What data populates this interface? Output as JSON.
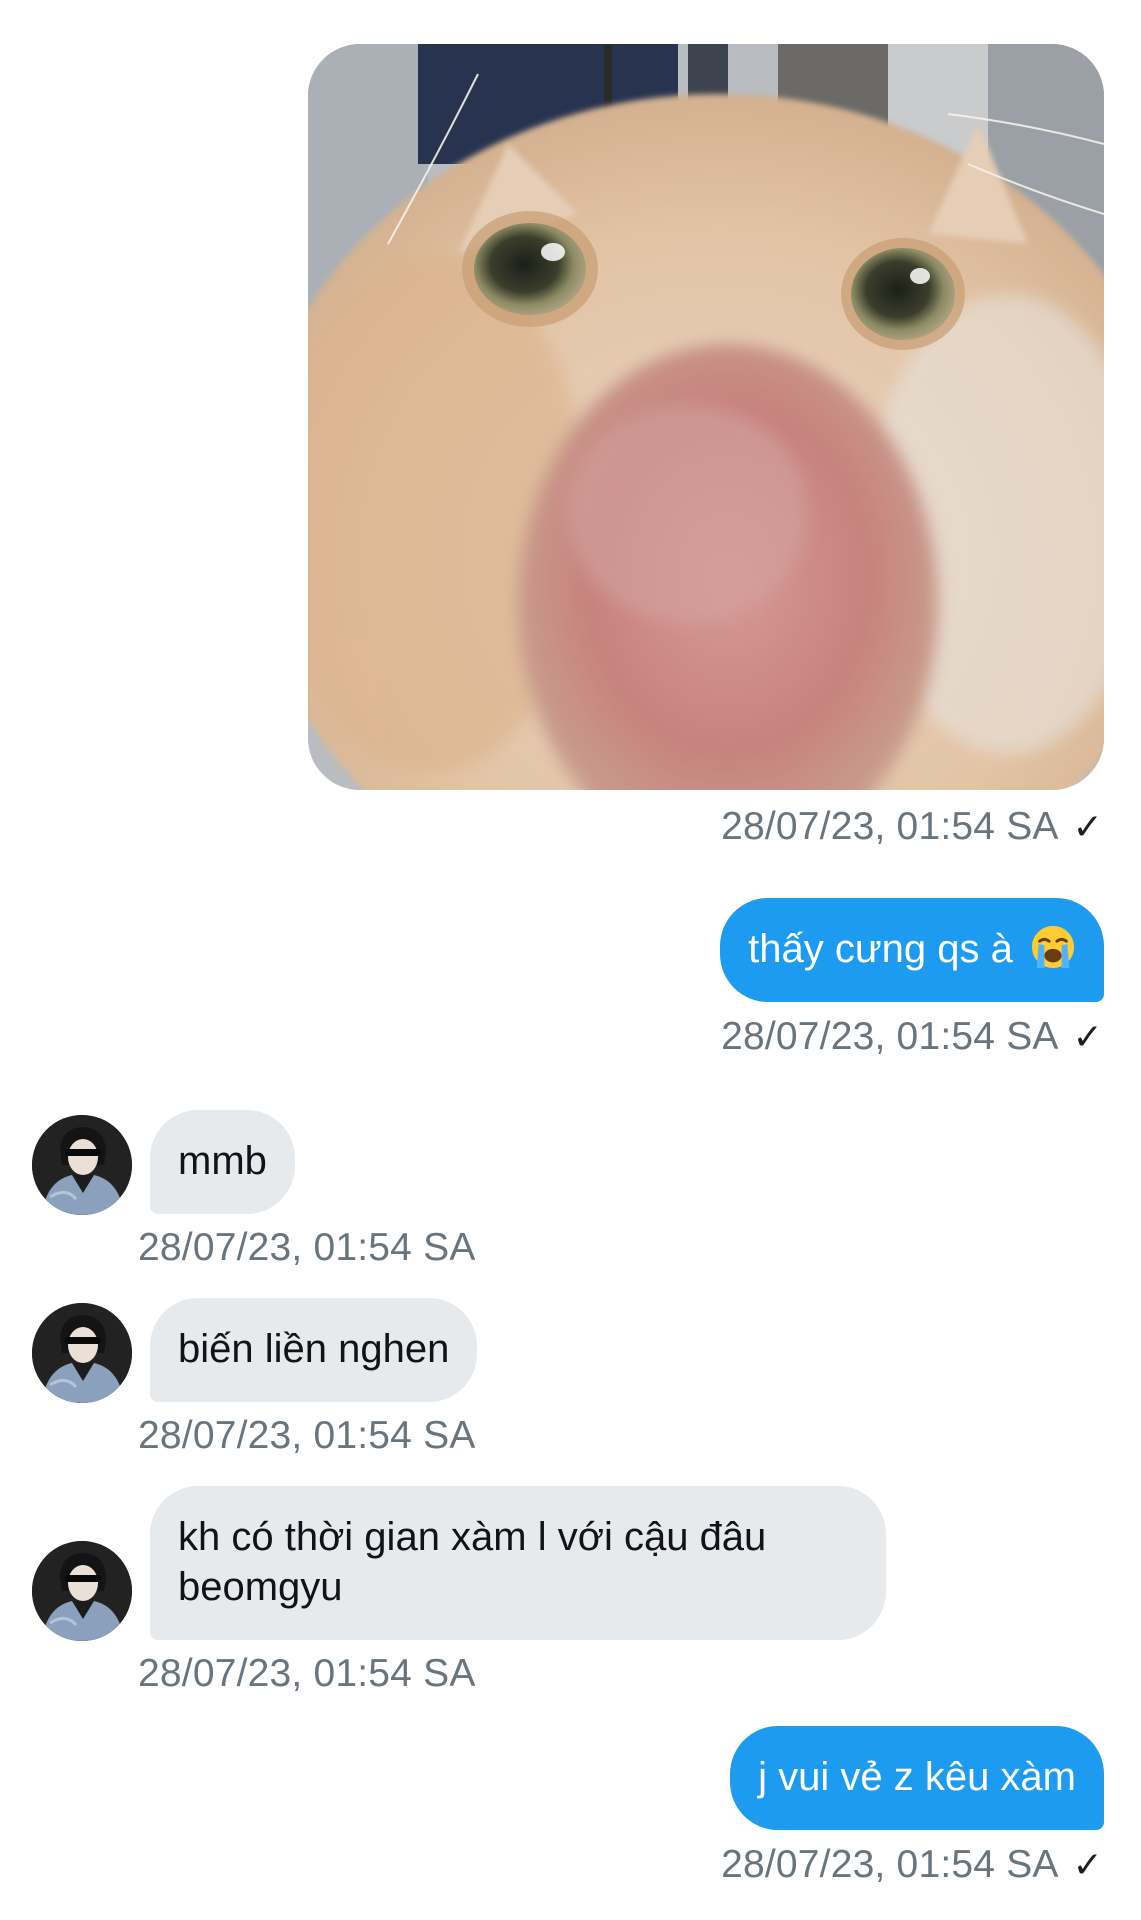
{
  "messages": [
    {
      "type": "image",
      "direction": "out",
      "alt_icon": "cat-closeup-photo",
      "timestamp": "28/07/23, 01:54 SA",
      "read_mark": "✓"
    },
    {
      "type": "text",
      "direction": "out",
      "text": "thấy cưng qs à",
      "emoji": "loudly-crying-face",
      "timestamp": "28/07/23, 01:54 SA",
      "read_mark": "✓"
    },
    {
      "type": "text",
      "direction": "in",
      "text": "mmb",
      "timestamp": "28/07/23, 01:54 SA"
    },
    {
      "type": "text",
      "direction": "in",
      "text": "biến liền nghen",
      "timestamp": "28/07/23, 01:54 SA"
    },
    {
      "type": "text",
      "direction": "in",
      "text": "kh có thời gian xàm l với cậu đâu beomgyu",
      "timestamp": "28/07/23, 01:54 SA"
    },
    {
      "type": "text",
      "direction": "out",
      "text": "j vui vẻ z kêu xàm",
      "timestamp": "28/07/23, 01:54 SA",
      "read_mark": "✓"
    }
  ],
  "colors": {
    "outgoing_bubble": "#1d9bf0",
    "incoming_bubble": "#e7eaed",
    "timestamp": "#68757f"
  }
}
